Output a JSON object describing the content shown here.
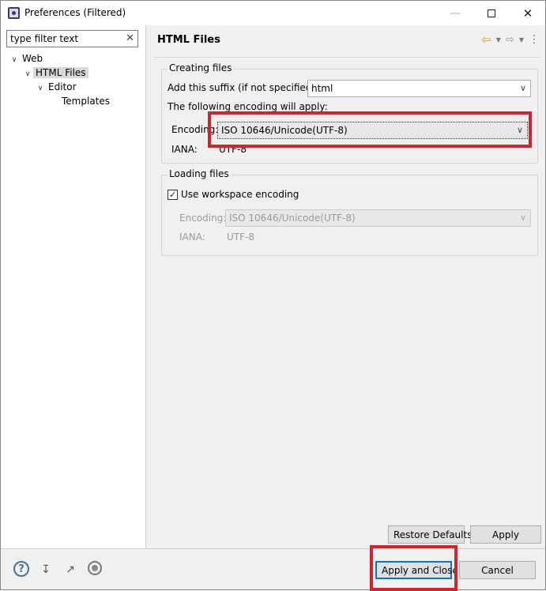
{
  "window": {
    "title": "Preferences (Filtered)"
  },
  "filter": {
    "value": "type filter text"
  },
  "tree": [
    {
      "label": "Web"
    },
    {
      "label": "HTML Files"
    },
    {
      "label": "Editor"
    },
    {
      "label": "Templates"
    }
  ],
  "page": {
    "title": "HTML Files",
    "creating": {
      "group_title": "Creating files",
      "suffix_label": "Add this suffix (if not specified):",
      "suffix_value": "html",
      "encoding_note": "The following encoding will apply:",
      "encoding_label": "Encoding:",
      "encoding_value": "ISO 10646/Unicode(UTF-8)",
      "iana_label": "IANA:",
      "iana_value": "UTF-8"
    },
    "loading": {
      "group_title": "Loading files",
      "workspace_label": "Use workspace encoding",
      "workspace_checked": true,
      "encoding_label": "Encoding:",
      "encoding_value": "ISO 10646/Unicode(UTF-8)",
      "iana_label": "IANA:",
      "iana_value": "UTF-8"
    },
    "restore_defaults": "Restore Defaults",
    "apply": "Apply"
  },
  "footer": {
    "apply_close": "Apply and Close",
    "cancel": "Cancel"
  },
  "colors": {
    "highlight": "#d1242f",
    "focus": "#0078d7"
  }
}
